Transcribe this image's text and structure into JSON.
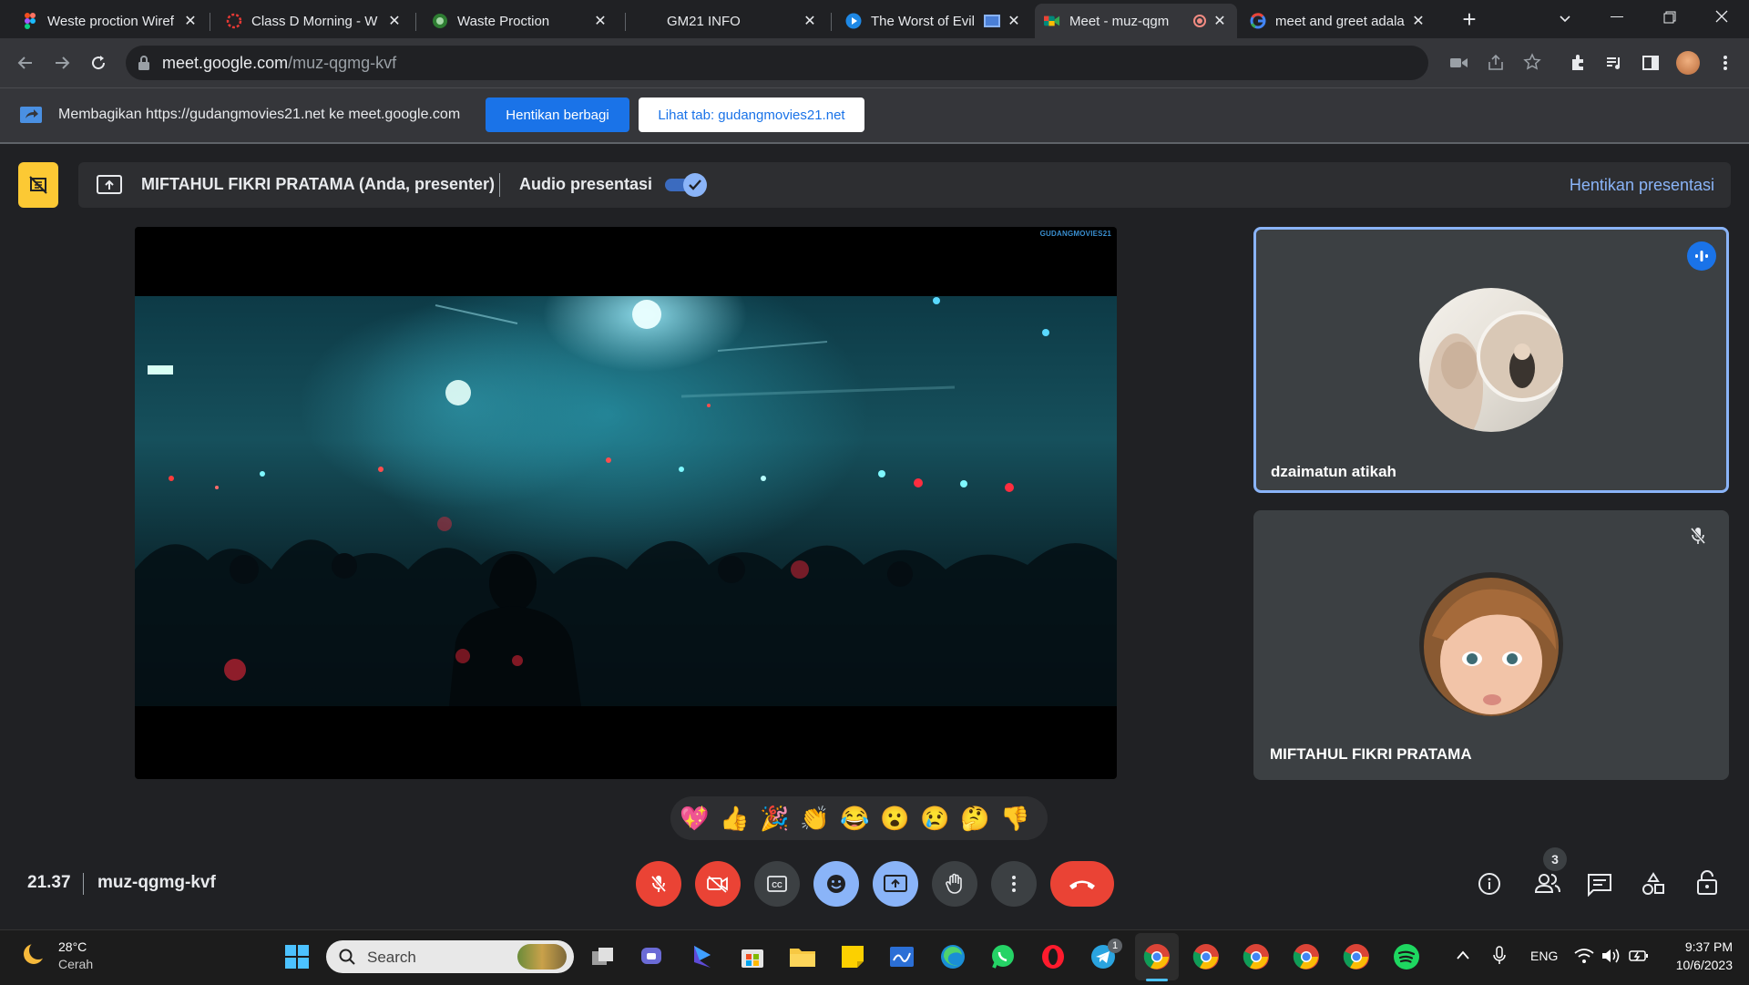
{
  "browser": {
    "tabs": [
      {
        "title": "Weste proction Wiref",
        "favicon": "figma-icon",
        "color": "#a259ff"
      },
      {
        "title": "Class D Morning - W",
        "favicon": "classroom-icon",
        "color": "#e53935"
      },
      {
        "title": "Waste Proction",
        "favicon": "app-icon",
        "color": "#4caf50"
      },
      {
        "title": "GM21 INFO",
        "favicon": "blank",
        "color": "#202124"
      },
      {
        "title": "The Worst of Evil",
        "favicon": "play-icon",
        "color": "#1e88e5"
      },
      {
        "title": "Meet - muz-qgm",
        "favicon": "meet-icon",
        "color": "#00897b",
        "active": true
      },
      {
        "title": "meet and greet adala",
        "favicon": "google-icon",
        "color": "#4285f4"
      }
    ],
    "new_tab_label": "+",
    "url_host": "meet.google.com",
    "url_path": "/muz-qgmg-kvf"
  },
  "share_bar": {
    "message": "Membagikan https://gudangmovies21.net ke meet.google.com",
    "stop_label": "Hentikan berbagi",
    "view_tab_label": "Lihat tab: gudangmovies21.net"
  },
  "presenter_bar": {
    "presenter": "MIFTAHUL FIKRI PRATAMA (Anda, presenter)",
    "audio_label": "Audio presentasi",
    "audio_on": true,
    "stop_presenting": "Hentikan presentasi"
  },
  "video": {
    "watermark": "GUDANGMOVIES21"
  },
  "participants": [
    {
      "name": "dzaimatun atikah",
      "speaking": true
    },
    {
      "name": "MIFTAHUL FIKRI PRATAMA",
      "muted": true
    }
  ],
  "reactions": [
    "💖",
    "👍",
    "🎉",
    "👏",
    "😂",
    "😮",
    "😢",
    "🤔",
    "👎"
  ],
  "meeting": {
    "time": "21.37",
    "code": "muz-qgmg-kvf",
    "people_count": "3"
  },
  "taskbar": {
    "weather_temp": "28°C",
    "weather_desc": "Cerah",
    "search_placeholder": "Search",
    "language": "ENG",
    "clock_time": "9:37 PM",
    "clock_date": "10/6/2023",
    "telegram_badge": "1"
  },
  "colors": {
    "accent_blue": "#1a73e8",
    "meet_blue": "#8ab4f8",
    "danger_red": "#ea4335",
    "surface": "#202124"
  }
}
